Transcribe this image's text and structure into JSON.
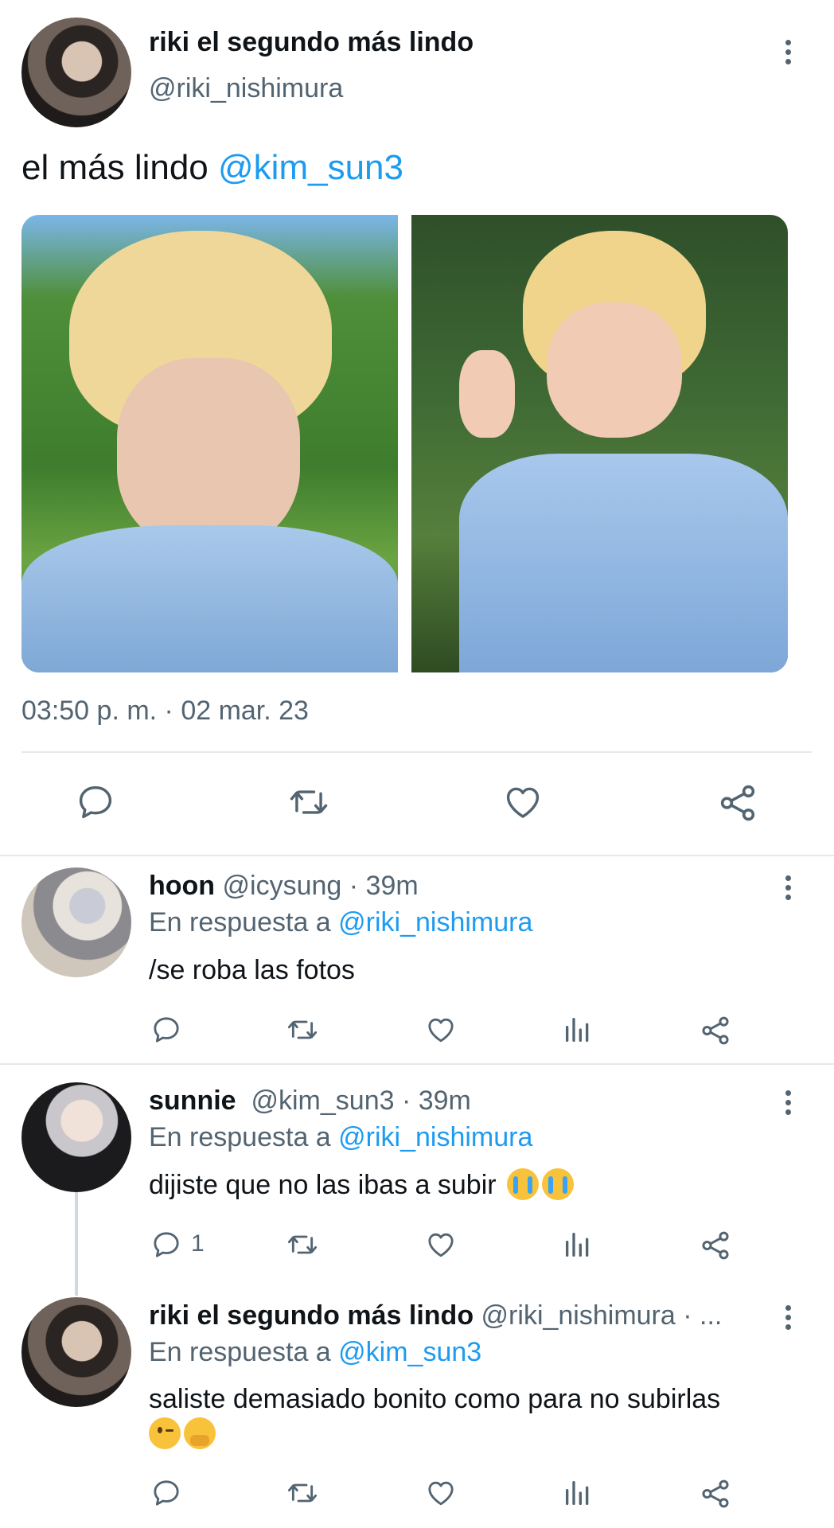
{
  "main_tweet": {
    "display_name": "riki el segundo más lindo",
    "handle": "@riki_nishimura",
    "text_prefix": "el más lindo ",
    "mention": "@kim_sun3",
    "timestamp": "03:50 p. m. · 02 mar. 23",
    "actions": [
      "reply-icon",
      "retweet-icon",
      "like-icon",
      "share-icon"
    ]
  },
  "replies": [
    {
      "display_name": "hoon",
      "handle_time": "@icysung · 39m",
      "replying_label": "En respuesta a",
      "replying_to": "@riki_nishimura",
      "text": "/se roba las fotos",
      "reply_count": ""
    },
    {
      "display_name": "sunnie",
      "handle_time": "@kim_sun3 · 39m",
      "replying_label": "En respuesta a",
      "replying_to": "@riki_nishimura",
      "text": "dijiste que no las ibas a subir",
      "reply_count": "1"
    },
    {
      "display_name": "riki el segundo más lindo",
      "handle_time": "@riki_nishimura · ...",
      "replying_label": "En respuesta a",
      "replying_to": "@kim_sun3",
      "text": "saliste demasiado bonito como para no subirlas",
      "reply_count": ""
    }
  ],
  "colors": {
    "link": "#1d9bf0",
    "secondary_text": "#536471",
    "divider": "#e6e9ec",
    "icon": "#536471"
  }
}
